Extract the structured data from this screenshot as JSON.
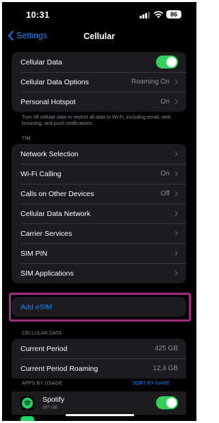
{
  "status": {
    "time": "10:31",
    "battery": "86"
  },
  "nav": {
    "back_label": "Settings",
    "title": "Cellular"
  },
  "group1": {
    "cellular_data_label": "Cellular Data",
    "cellular_data_on": true,
    "options_label": "Cellular Data Options",
    "options_value": "Roaming On",
    "hotspot_label": "Personal Hotspot",
    "hotspot_value": "On"
  },
  "footer_note": "Turn off cellular data to restrict all data to Wi-Fi, including email, web browsing, and push notifications.",
  "carrier_header": "TIM",
  "carrier_rows": [
    {
      "label": "Network Selection",
      "value": ""
    },
    {
      "label": "Wi-Fi Calling",
      "value": "On"
    },
    {
      "label": "Calls on Other Devices",
      "value": "Off"
    },
    {
      "label": "Cellular Data Network",
      "value": ""
    },
    {
      "label": "Carrier Services",
      "value": ""
    },
    {
      "label": "SIM PIN",
      "value": ""
    },
    {
      "label": "SIM Applications",
      "value": ""
    }
  ],
  "add_esim_label": "Add eSIM",
  "usage_header": "CELLULAR DATA",
  "usage_rows": [
    {
      "label": "Current Period",
      "value": "425 GB"
    },
    {
      "label": "Current Period Roaming",
      "value": "12,4 GB"
    }
  ],
  "apps_header": "APPS BY USAGE",
  "sort_label": "SORT BY NAME",
  "apps": [
    {
      "name": "Spotify",
      "size": "187 GB",
      "enabled": true
    }
  ],
  "colors": {
    "accent": "#0a84ff",
    "toggle_on": "#30d158",
    "highlight": "#a32a82",
    "spotify": "#1ed760"
  }
}
